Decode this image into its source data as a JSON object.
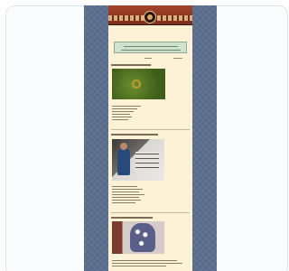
{
  "page": {
    "title": "",
    "banner_logo": "circle-emblem-icon"
  },
  "colors": {
    "side_background": "#5b6f8f",
    "content_background": "#fdf2d5",
    "banner": "#8f3a22",
    "notice_box": "#cfe2cf"
  },
  "sections": [
    {
      "photo": "green-field-with-ring"
    },
    {
      "photo": "person-with-artwork"
    },
    {
      "photo": "patterned-vase"
    }
  ]
}
